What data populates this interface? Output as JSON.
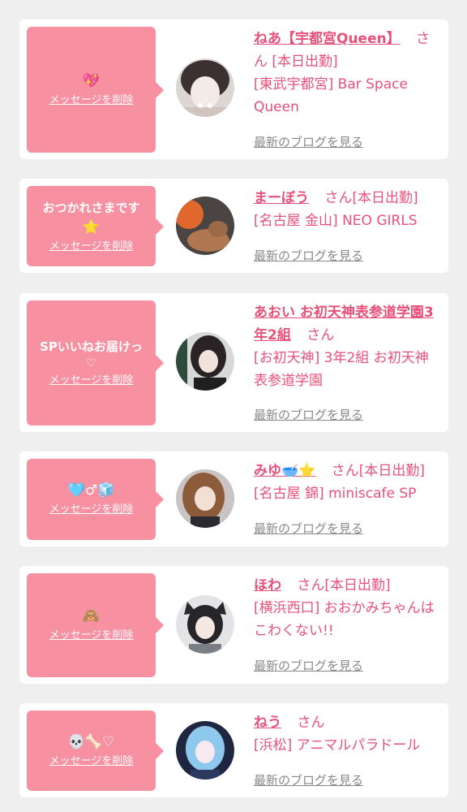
{
  "entries": [
    {
      "message": "",
      "emoji": "💖",
      "delete_label": "メッセージを削除",
      "name": "ねあ【宇都宮Queen】",
      "honorific": "さん",
      "status": "[本日出勤]",
      "area": "[東武宇都宮]",
      "shop": "Bar Space Queen",
      "blog_label": "最新のブログを見る"
    },
    {
      "message": "おつかれさまです",
      "emoji": "⭐",
      "delete_label": "メッセージを削除",
      "name": "まーぼう",
      "honorific": "さん",
      "status": "[本日出勤]",
      "area": "[名古屋 金山]",
      "shop": "NEO GIRLS",
      "blog_label": "最新のブログを見る"
    },
    {
      "message": "SPいいねお届けっ",
      "emoji": "♡",
      "delete_label": "メッセージを削除",
      "name": "あおい お初天神表参道学園3年2組",
      "honorific": "さん",
      "status": "",
      "area": "[お初天神]",
      "shop": "3年2組 お初天神表参道学園",
      "blog_label": "最新のブログを見る"
    },
    {
      "message": "",
      "emoji": "🩵♂🧊",
      "delete_label": "メッセージを削除",
      "name": "みゆ🥣⭐",
      "honorific": "さん",
      "status": "[本日出勤]",
      "area": "[名古屋 錦]",
      "shop": "miniscafe SP",
      "blog_label": "最新のブログを見る"
    },
    {
      "message": "",
      "emoji": "🙈",
      "delete_label": "メッセージを削除",
      "name": "ほわ",
      "honorific": "さん",
      "status": "[本日出勤]",
      "area": "[横浜西口]",
      "shop": "おおかみちゃんはこわくない!!",
      "blog_label": "最新のブログを見る"
    },
    {
      "message": "",
      "emoji": "💀🦴♡",
      "delete_label": "メッセージを削除",
      "name": "ねう",
      "honorific": "さん",
      "status": "",
      "area": "[浜松]",
      "shop": "アニマルパラドール",
      "blog_label": "最新のブログを見る"
    }
  ],
  "colors": {
    "background": "#efefef",
    "card": "#ffffff",
    "bubble": "#f790a0",
    "accent": "#e8517a",
    "link_gray": "#888888"
  }
}
